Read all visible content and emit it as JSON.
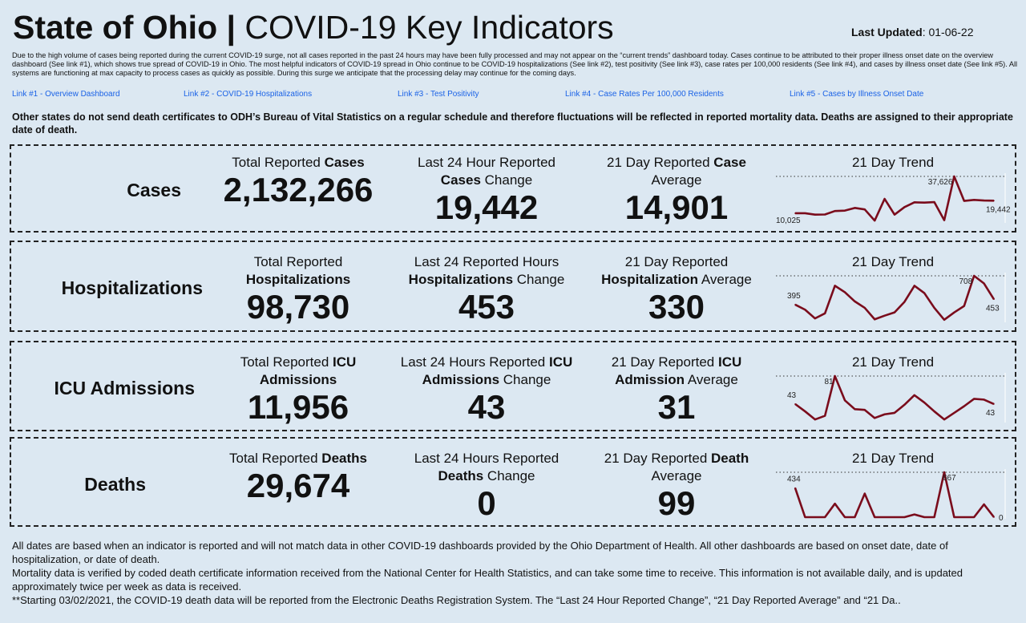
{
  "header": {
    "title_bold": "State of Ohio |",
    "title_rest": "COVID-19  Key Indicators",
    "last_updated_label": "Last Updated",
    "last_updated_value": ": 01-06-22"
  },
  "notice": "Due to the high volume of cases being reported during the current COVID-19 surge, not all cases reported in the past 24 hours may have been fully processed and may not appear on the “current trends” dashboard today. Cases continue to be attributed to their proper illness onset date on the overview dashboard (See link #1), which shows true spread of COVID-19 in Ohio. The most helpful indicators of COVID-19 spread in Ohio continue to be COVID-19 hospitalizations (See link #2), test positivity (See link #3), case rates per 100,000 residents (See link #4), and cases by illness onset date (See link #5). All systems are functioning at max capacity to process cases as quickly as possible. During this surge we anticipate that the processing delay may continue for the coming days.",
  "links": [
    {
      "label": "Link #1 - Overview Dashboard"
    },
    {
      "label": "Link #2 - COVID-19 Hospitalizations"
    },
    {
      "label": "Link #3 - Test Positivity"
    },
    {
      "label": "Link #4 - Case Rates Per 100,000 Residents"
    },
    {
      "label": "Link #5 - Cases by Illness Onset Date"
    }
  ],
  "death_note": "Other states do not send death certificates to ODH’s Bureau of Vital Statistics on a regular schedule and therefore fluctuations will be reflected in reported mortality data. Deaths are assigned to their appropriate date of death.",
  "trend_title": "21 Day Trend",
  "line_color": "#7a0c1c",
  "rows": [
    {
      "label": "Cases",
      "total": {
        "pre": "Total Reported ",
        "bold": "Cases",
        "post": "",
        "value": "2,132,266"
      },
      "change": {
        "pre": "Last 24 Hour Reported ",
        "bold": "Cases",
        "post": " Change",
        "value": "19,442"
      },
      "average": {
        "pre": "21 Day Reported ",
        "bold": "Case",
        "post": " Average",
        "value": "14,901"
      }
    },
    {
      "label": "Hospitalizations",
      "total": {
        "pre": "Total Reported ",
        "bold": "Hospitalizations",
        "post": "",
        "value": "98,730"
      },
      "change": {
        "pre": "Last 24 Reported Hours ",
        "bold": "Hospitalizations",
        "post": " Change",
        "value": "453"
      },
      "average": {
        "pre": "21 Day Reported ",
        "bold": "Hospitalization",
        "post": " Average",
        "value": "330"
      }
    },
    {
      "label": "ICU Admissions",
      "total": {
        "pre": "Total Reported ",
        "bold": "ICU Admissions",
        "post": "",
        "value": "11,956"
      },
      "change": {
        "pre": "Last 24 Hours Reported ",
        "bold": "ICU Admissions",
        "post": " Change",
        "value": "43"
      },
      "average": {
        "pre": "21 Day Reported ",
        "bold": "ICU Admission",
        "post": " Average",
        "value": "31"
      }
    },
    {
      "label": "Deaths",
      "total": {
        "pre": "Total Reported ",
        "bold": "Deaths",
        "post": "",
        "value": "29,674"
      },
      "change": {
        "pre": "Last 24 Hours Reported ",
        "bold": "Deaths",
        "post": " Change",
        "value": "0"
      },
      "average": {
        "pre": "21 Day Reported ",
        "bold": "Death",
        "post": " Average",
        "value": "99"
      }
    }
  ],
  "chart_data": [
    {
      "type": "line",
      "title": "21 Day Trend",
      "series_name": "Cases",
      "values": [
        10025,
        10025,
        9000,
        9100,
        11700,
        12000,
        14000,
        12900,
        4500,
        20800,
        9000,
        14600,
        18200,
        18000,
        18400,
        4800,
        37626,
        19300,
        20000,
        19600,
        19442
      ],
      "labels": {
        "first": "10,025",
        "max": "37,626",
        "last": "19,442"
      },
      "ylim": [
        4000,
        37626
      ]
    },
    {
      "type": "line",
      "title": "21 Day Trend",
      "series_name": "Hospitalizations",
      "values": [
        395,
        340,
        245,
        300,
        600,
        530,
        430,
        360,
        235,
        275,
        310,
        425,
        600,
        520,
        360,
        230,
        310,
        380,
        708,
        625,
        453
      ],
      "labels": {
        "first": "395",
        "max": "708",
        "last": "453"
      },
      "ylim": [
        220,
        708
      ]
    },
    {
      "type": "line",
      "title": "21 Day Trend",
      "series_name": "ICU Admissions",
      "values": [
        43,
        33,
        22,
        27,
        81,
        48,
        36,
        35,
        24,
        29,
        31,
        42,
        55,
        45,
        33,
        22,
        31,
        40,
        50,
        49,
        43
      ],
      "labels": {
        "first": "43",
        "max": "81",
        "last": "43"
      },
      "ylim": [
        20,
        81
      ]
    },
    {
      "type": "line",
      "title": "21 Day Trend",
      "series_name": "Deaths",
      "values": [
        434,
        0,
        0,
        0,
        200,
        0,
        0,
        350,
        0,
        0,
        0,
        0,
        40,
        0,
        0,
        667,
        0,
        0,
        0,
        190,
        0
      ],
      "labels": {
        "first": "434",
        "max": "667",
        "last": "0"
      },
      "ylim": [
        0,
        667
      ]
    }
  ],
  "footer": [
    "All dates are based when an indicator is reported and will not match data in other COVID-19 dashboards provided by the Ohio Department of Health. All other dashboards are based on onset date, date of hospitalization, or date of death.",
    "Mortality data is verified by coded death certificate information received from the National Center for Health Statistics, and can take some time to receive. This information is not available daily, and is updated approximately twice per week as data is received.",
    "**Starting 03/02/2021, the COVID-19 death data will be reported from the Electronic Deaths Registration System. The “Last 24 Hour Reported Change”, “21 Day Reported Average” and “21 Da.."
  ]
}
